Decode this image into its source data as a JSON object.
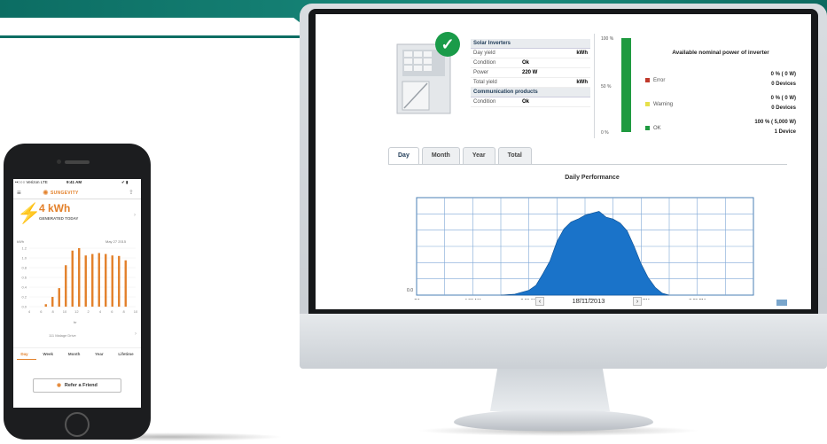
{
  "colors": {
    "banner": "#0c6d63",
    "ok_green": "#1f9a40",
    "error_red": "#c0392b",
    "warning_yellow": "#e6e04a",
    "chart_fill": "#1a73c9",
    "sungevity_orange": "#e3802a"
  },
  "inverter_panel": {
    "solar_header": "Solar Inverters",
    "rows": [
      {
        "key": "Day yield",
        "value": "",
        "unit": "kWh"
      },
      {
        "key": "Condition",
        "value": "Ok",
        "unit": ""
      },
      {
        "key": "Power",
        "value": "220  W",
        "unit": ""
      },
      {
        "key": "Total yield",
        "value": "",
        "unit": "kWh"
      }
    ],
    "comm_header": "Communication products",
    "comm_row": {
      "key": "Condition",
      "value": "Ok"
    }
  },
  "gauge": {
    "top_label": "100 %",
    "mid_label": "50 %",
    "bottom_label": "0 %",
    "level_percent": 100
  },
  "availability": {
    "title": "Available nominal power of inverter",
    "statuses": [
      {
        "name": "Error",
        "percent": "0 %  ( 0 W)",
        "devices": "0 Devices",
        "color": "#c0392b"
      },
      {
        "name": "Warning",
        "percent": "0 %  ( 0 W)",
        "devices": "0 Devices",
        "color": "#e6e04a"
      },
      {
        "name": "OK",
        "percent": "100 %  ( 5,000 W)",
        "devices": "1 Device",
        "color": "#1f9a40"
      }
    ]
  },
  "tabs": [
    "Day",
    "Month",
    "Year",
    "Total"
  ],
  "active_tab": "Day",
  "date": "18/11/2013",
  "chart_data": {
    "type": "area",
    "title": "Daily Performance",
    "x_ticks": [
      "4M",
      "4:00 AM",
      "8:00 AM",
      "12:00 PM",
      "4:00 PM",
      "8:00 PM"
    ],
    "y_ticks": [
      "0.0"
    ],
    "grid": true,
    "x_hours": [
      6,
      7,
      8,
      8.5,
      9,
      9.5,
      10,
      10.5,
      11,
      11.5,
      12,
      12.5,
      13,
      13.5,
      14,
      14.5,
      15,
      15.5,
      16,
      16.5,
      17,
      17.5,
      18
    ],
    "values": [
      0,
      0.01,
      0.05,
      0.1,
      0.22,
      0.35,
      0.55,
      0.68,
      0.75,
      0.78,
      0.82,
      0.84,
      0.86,
      0.8,
      0.78,
      0.74,
      0.66,
      0.5,
      0.32,
      0.18,
      0.08,
      0.02,
      0
    ],
    "ylim": [
      0,
      1
    ]
  },
  "phone": {
    "carrier": "••○○○ Verizon  LTE",
    "time": "9:41 AM",
    "battery": "✔ ▮",
    "brand": "SUNGEVITY",
    "kwh": "4 kWh",
    "kwh_label": "GENERATED TODAY",
    "unit": "kWh",
    "chart_date": "May 27 2015",
    "y_ticks": [
      "1.2",
      "1.0",
      "0.8",
      "0.6",
      "0.4",
      "0.2",
      "0.0"
    ],
    "x_ticks": [
      "4",
      "6",
      "8",
      "10",
      "12",
      "2",
      "4",
      "6",
      "8",
      "10"
    ],
    "x_sub": "hr",
    "hourly_kwh": [
      0.05,
      0.2,
      0.38,
      0.85,
      1.15,
      1.2,
      1.05,
      1.08,
      1.1,
      1.08,
      1.05,
      1.04,
      0.95
    ],
    "feed_label": "111 Malage Drive",
    "tabs": [
      "Day",
      "Week",
      "Month",
      "Year",
      "Lifetime"
    ],
    "active_tab": "Day",
    "refer_label": "Refer a Friend"
  }
}
